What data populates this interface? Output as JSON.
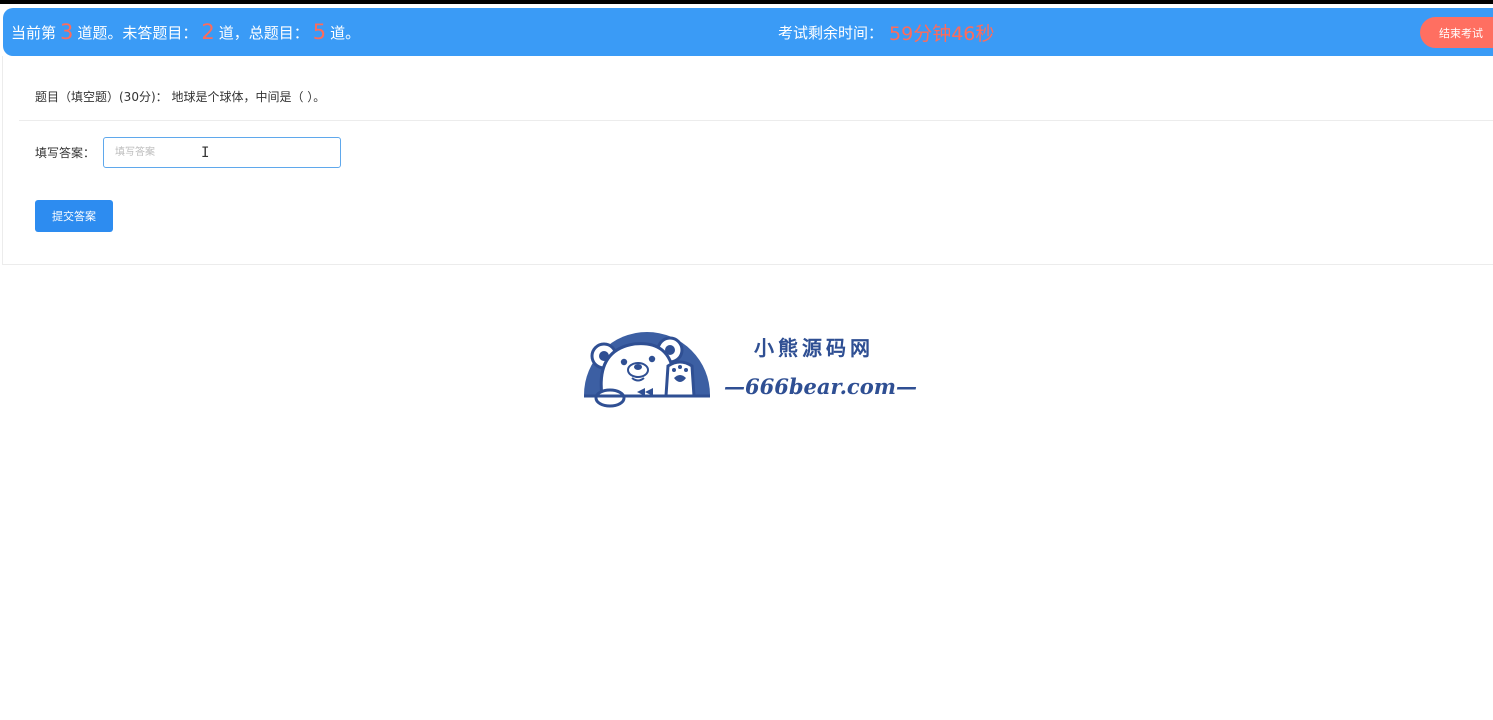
{
  "header": {
    "status_prefix": "当前第",
    "current_question": "3",
    "status_mid1": "道题。未答题目：",
    "unanswered": "2",
    "status_mid2": "道，总题目：",
    "total": "5",
    "status_suffix": "道。",
    "timer_label": "考试剩余时间：",
    "timer_value": "59分钟46秒",
    "end_button": "结束考试"
  },
  "question": {
    "text": "题目（填空题）(30分)： 地球是个球体，中间是（   ）。"
  },
  "answer": {
    "label": "填写答案：",
    "placeholder": "填写答案",
    "value": ""
  },
  "submit_button": "提交答案",
  "logo": {
    "cn_text": "小熊源码网",
    "en_text": "—666bear.com—"
  },
  "colors": {
    "header_bg": "#3a9bf6",
    "accent_number": "#ff6b5a",
    "end_button_bg": "#ff6f61",
    "submit_bg": "#2d8cf0",
    "logo_blue": "#2f4f93"
  },
  "icons": [
    "text-cursor-icon",
    "bear-logo-icon"
  ]
}
